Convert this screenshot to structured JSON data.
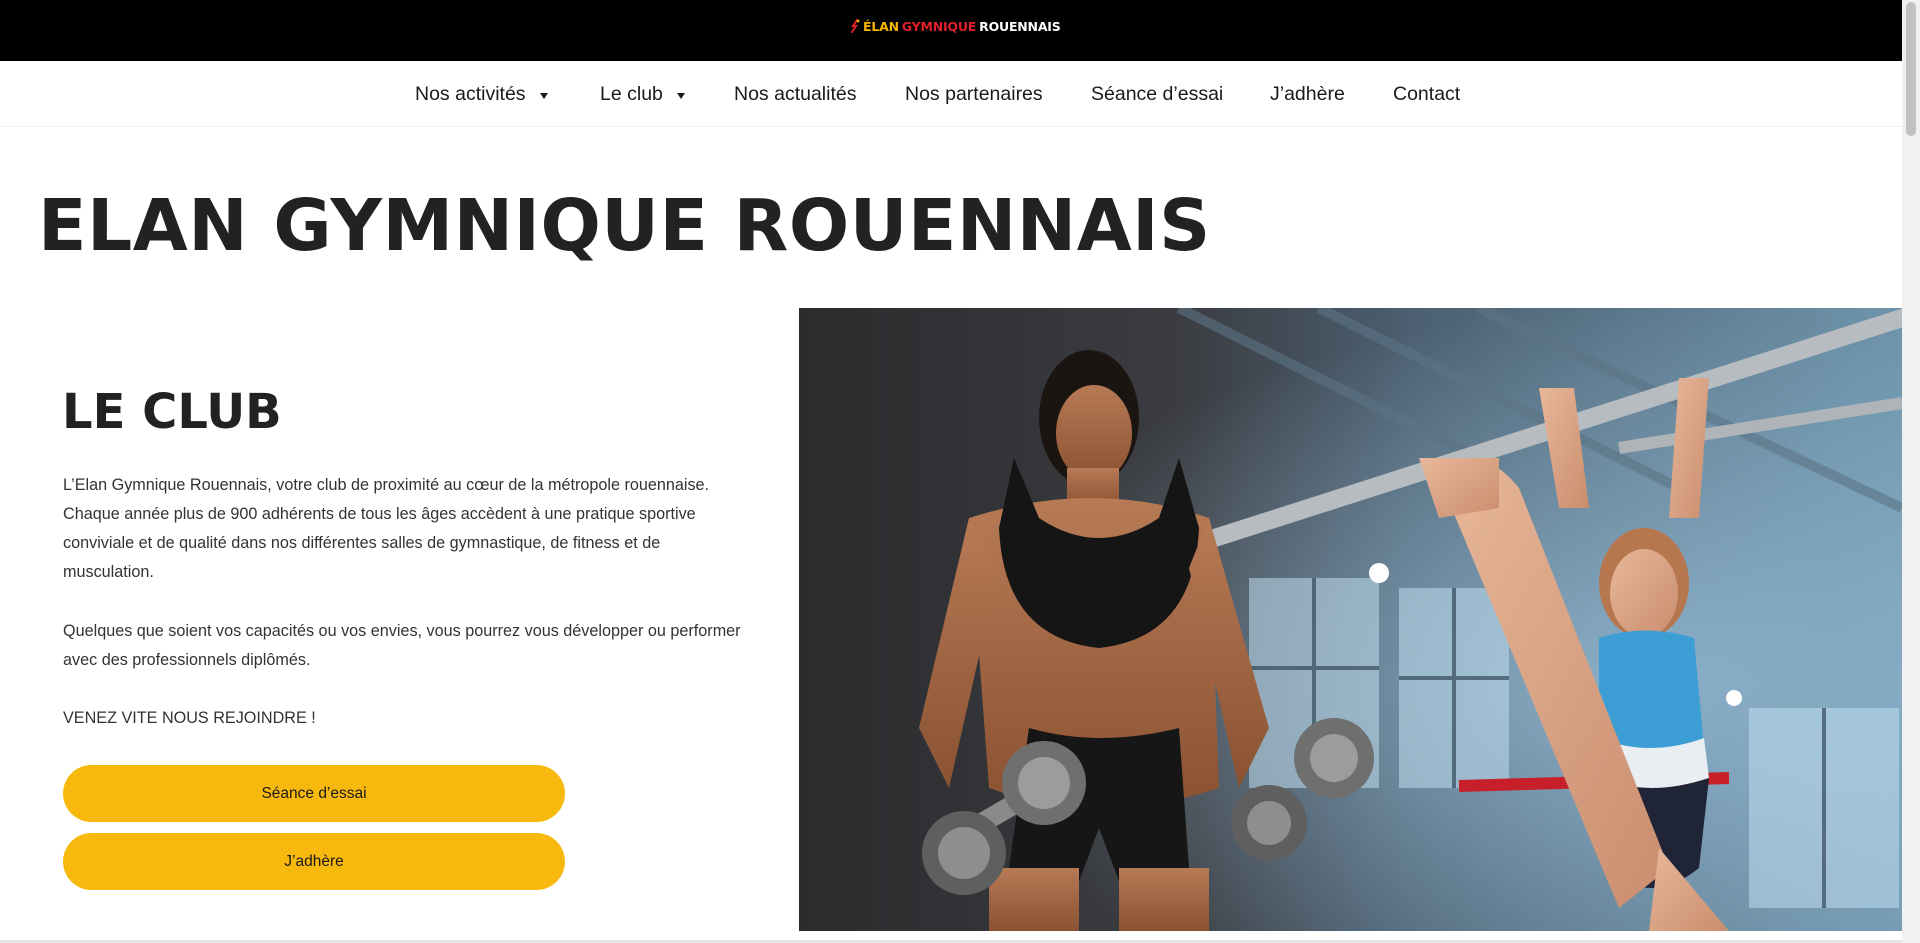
{
  "logo": {
    "word1": "ÉLAN",
    "word2": "GYMNIQUE",
    "word3": "ROUENNAIS",
    "colors": {
      "yellow": "#f5b400",
      "red": "#e0202b",
      "white": "#ffffff"
    }
  },
  "nav": {
    "items": [
      {
        "label": "Nos activités",
        "dropdown": true
      },
      {
        "label": "Le club",
        "dropdown": true
      },
      {
        "label": "Nos actualités",
        "dropdown": false
      },
      {
        "label": "Nos partenaires",
        "dropdown": false
      },
      {
        "label": "Séance d’essai",
        "dropdown": false
      },
      {
        "label": "J’adhère",
        "dropdown": false
      },
      {
        "label": "Contact",
        "dropdown": false
      }
    ]
  },
  "main": {
    "title": "ELAN GYMNIQUE ROUENNAIS",
    "section_title": "LE CLUB",
    "paragraph1": "L’Elan Gymnique Rouennais, votre club de proximité au cœur de la métropole rouennaise. Chaque année plus de 900 adhérents de tous les âges accèdent à une pratique sportive conviviale et de qualité dans nos différentes salles de gymnastique, de fitness et de musculation.",
    "paragraph2": "Quelques que soient vos capacités ou vos envies, vous pourrez vous développer ou performer avec des professionnels diplômés.",
    "paragraph3": "VENEZ VITE NOUS REJOINDRE !",
    "cta_trial": "Séance d’essai",
    "cta_join": "J’adhère"
  },
  "theme": {
    "accent": "#f8b90f",
    "topbar": "#000000"
  }
}
